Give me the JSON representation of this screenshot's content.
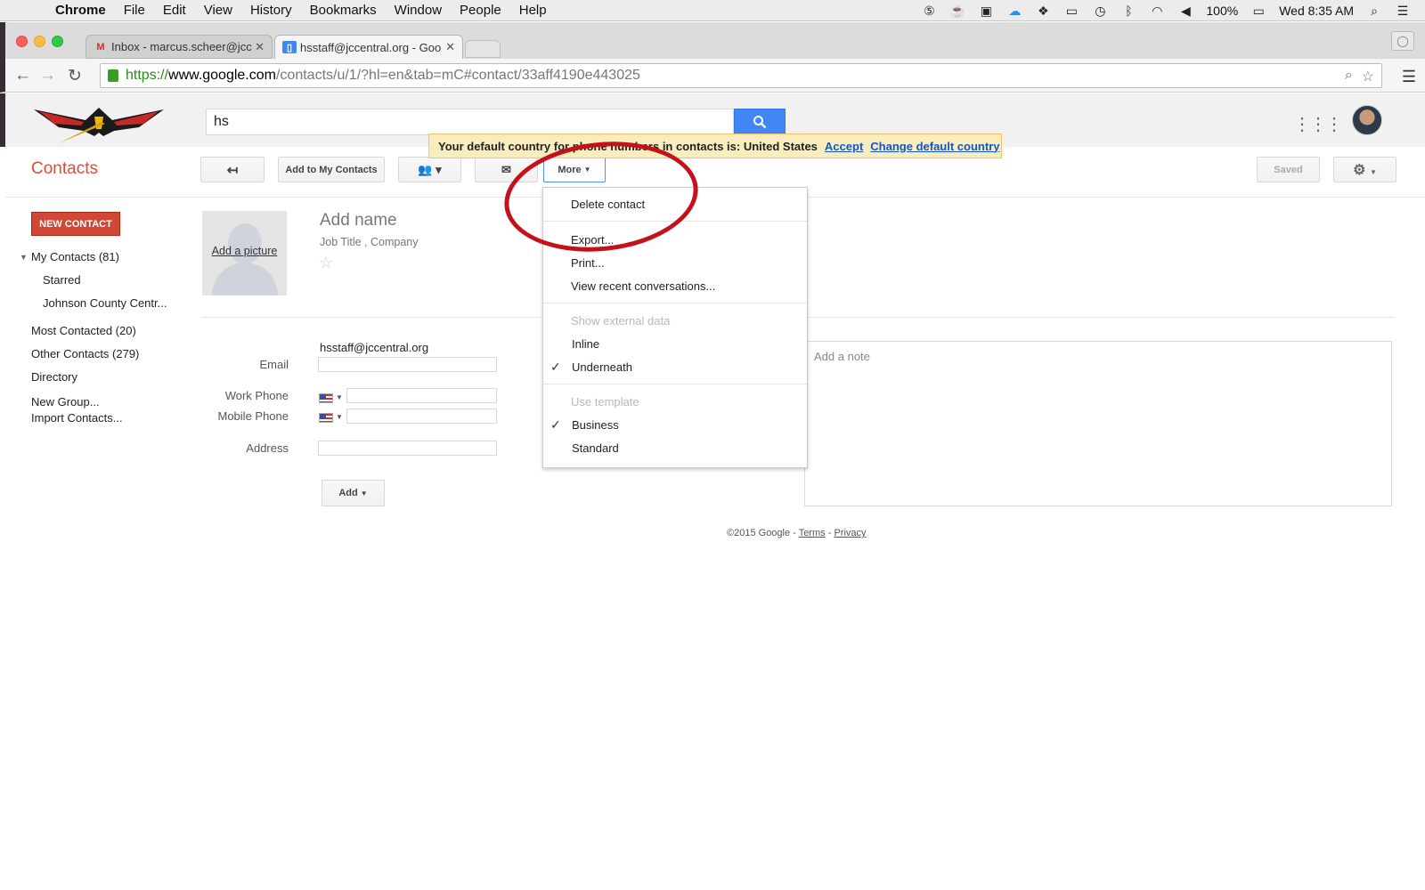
{
  "menubar": {
    "items": [
      "Chrome",
      "File",
      "Edit",
      "View",
      "History",
      "Bookmarks",
      "Window",
      "People",
      "Help"
    ],
    "battery": "100%",
    "clock": "Wed 8:35 AM"
  },
  "tabs": [
    {
      "title": "Inbox - marcus.scheer@jcc",
      "favicon": "gmail-icon"
    },
    {
      "title": "hsstaff@jccentral.org - Goo",
      "favicon": "contacts-icon"
    }
  ],
  "url": {
    "scheme": "https://",
    "host": "www.google.com",
    "path": "/contacts/u/1/?hl=en&tab=mC#contact/33aff4190e443025"
  },
  "search": {
    "value": "hs"
  },
  "notice": {
    "text": "Your default country for phone numbers in contacts is: United States",
    "accept": "Accept",
    "change": "Change default country"
  },
  "toolbar": {
    "title": "Contacts",
    "add_to_my_contacts": "Add to My Contacts",
    "more": "More",
    "saved": "Saved"
  },
  "sidebar": {
    "new_contact": "NEW CONTACT",
    "my_contacts": "My Contacts (81)",
    "starred": "Starred",
    "group": "Johnson County Centr...",
    "most_contacted": "Most Contacted (20)",
    "other_contacts": "Other Contacts (279)",
    "directory": "Directory",
    "new_group": "New Group...",
    "import": "Import Contacts..."
  },
  "contact": {
    "add_picture": "Add a picture",
    "add_name": "Add name",
    "job_title": "Job Title",
    "company": "Company",
    "email_value": "hsstaff@jccentral.org",
    "email_label": "Email",
    "work_phone_label": "Work Phone",
    "mobile_phone_label": "Mobile Phone",
    "address_label": "Address",
    "add_button": "Add",
    "note_placeholder": "Add a note"
  },
  "footer": {
    "copyright": "©2015 Google -",
    "terms": "Terms",
    "privacy": "Privacy"
  },
  "more_menu": {
    "delete": "Delete contact",
    "export": "Export...",
    "print": "Print...",
    "recent": "View recent conversations...",
    "external_header": "Show external data",
    "inline": "Inline",
    "underneath": "Underneath",
    "template_header": "Use template",
    "business": "Business",
    "standard": "Standard"
  },
  "colors": {
    "accent_red": "#dd4b39",
    "search_blue": "#4285f4",
    "annotation_circle": "#c4121a"
  }
}
